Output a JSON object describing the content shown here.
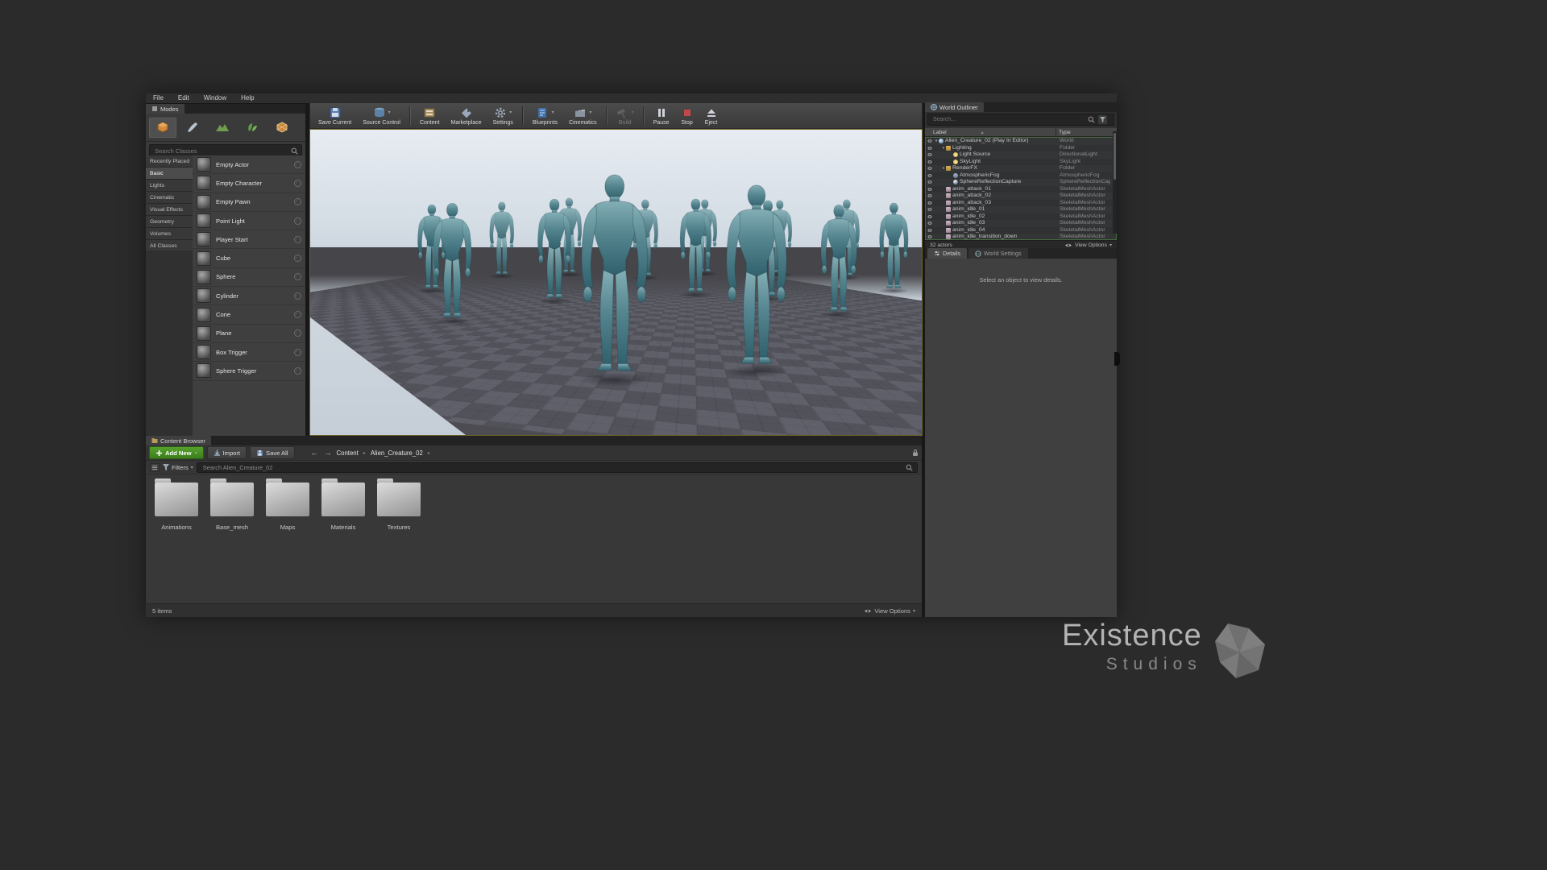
{
  "menu": {
    "items": [
      {
        "label": "File"
      },
      {
        "label": "Edit"
      },
      {
        "label": "Window"
      },
      {
        "label": "Help"
      }
    ]
  },
  "modes": {
    "tab": "Modes",
    "search_placeholder": "Search Classes",
    "categories": [
      {
        "label": "Recently Placed",
        "active": false
      },
      {
        "label": "Basic",
        "active": true
      },
      {
        "label": "Lights",
        "active": false
      },
      {
        "label": "Cinematic",
        "active": false
      },
      {
        "label": "Visual Effects",
        "active": false
      },
      {
        "label": "Geometry",
        "active": false
      },
      {
        "label": "Volumes",
        "active": false
      },
      {
        "label": "All Classes",
        "active": false
      }
    ],
    "items": [
      {
        "label": "Empty Actor"
      },
      {
        "label": "Empty Character"
      },
      {
        "label": "Empty Pawn"
      },
      {
        "label": "Point Light"
      },
      {
        "label": "Player Start"
      },
      {
        "label": "Cube"
      },
      {
        "label": "Sphere"
      },
      {
        "label": "Cylinder"
      },
      {
        "label": "Cone"
      },
      {
        "label": "Plane"
      },
      {
        "label": "Box Trigger"
      },
      {
        "label": "Sphere Trigger"
      }
    ]
  },
  "toolbar": {
    "save_current": "Save Current",
    "source_control": "Source Control",
    "content": "Content",
    "marketplace": "Marketplace",
    "settings": "Settings",
    "blueprints": "Blueprints",
    "cinematics": "Cinematics",
    "build": "Build",
    "pause": "Pause",
    "stop": "Stop",
    "eject": "Eject"
  },
  "outliner": {
    "tab": "World Outliner",
    "search_placeholder": "Search...",
    "col_label": "Label",
    "col_type": "Type",
    "rows": [
      {
        "label": "Alien_Creature_02 (Play In Editor)",
        "type": "World",
        "indent": 0,
        "icon": "world",
        "expand": true
      },
      {
        "label": "Lighting",
        "type": "Folder",
        "indent": 1,
        "icon": "folder",
        "expand": true
      },
      {
        "label": "Light Source",
        "type": "DirectionalLight",
        "indent": 2,
        "icon": "dirlight",
        "expand": false
      },
      {
        "label": "SkyLight",
        "type": "SkyLight",
        "indent": 2,
        "icon": "skylight",
        "expand": false
      },
      {
        "label": "RenderFX",
        "type": "Folder",
        "indent": 1,
        "icon": "folder",
        "expand": true
      },
      {
        "label": "AtmosphericFog",
        "type": "AtmosphericFog",
        "indent": 2,
        "icon": "fog",
        "expand": false
      },
      {
        "label": "SphereReflectionCapture",
        "type": "SphereReflectionCapture",
        "indent": 2,
        "icon": "refl",
        "expand": false
      },
      {
        "label": "anim_attack_01",
        "type": "SkeletalMeshActor",
        "indent": 1,
        "icon": "skel",
        "expand": false
      },
      {
        "label": "anim_attack_02",
        "type": "SkeletalMeshActor",
        "indent": 1,
        "icon": "skel",
        "expand": false
      },
      {
        "label": "anim_attack_03",
        "type": "SkeletalMeshActor",
        "indent": 1,
        "icon": "skel",
        "expand": false
      },
      {
        "label": "anim_idle_01",
        "type": "SkeletalMeshActor",
        "indent": 1,
        "icon": "skel",
        "expand": false
      },
      {
        "label": "anim_idle_02",
        "type": "SkeletalMeshActor",
        "indent": 1,
        "icon": "skel",
        "expand": false
      },
      {
        "label": "anim_idle_03",
        "type": "SkeletalMeshActor",
        "indent": 1,
        "icon": "skel",
        "expand": false
      },
      {
        "label": "anim_idle_04",
        "type": "SkeletalMeshActor",
        "indent": 1,
        "icon": "skel",
        "expand": false
      },
      {
        "label": "anim_idle_transition_down",
        "type": "SkeletalMeshActor",
        "indent": 1,
        "icon": "skel",
        "expand": false
      }
    ],
    "footer": "32 actors",
    "view_options": "View Options"
  },
  "details": {
    "tab_details": "Details",
    "tab_world": "World Settings",
    "empty": "Select an object to view details."
  },
  "content_browser": {
    "tab": "Content Browser",
    "add_new": "Add New",
    "import": "Import",
    "save_all": "Save All",
    "crumb_root": "Content",
    "crumb_current": "Alien_Creature_02",
    "filters": "Filters",
    "search_placeholder": "Search Alien_Creature_02",
    "folders": [
      {
        "label": "Animations"
      },
      {
        "label": "Base_mesh"
      },
      {
        "label": "Maps"
      },
      {
        "label": "Materials"
      },
      {
        "label": "Textures"
      }
    ],
    "footer": "5 items",
    "view_options": "View Options"
  },
  "watermark": {
    "line1": "Existence",
    "line2": "Studios"
  },
  "colors": {
    "add_new_green": "#4a9427",
    "pie_border": "#6e6324",
    "alien_skin": "#55858f"
  }
}
